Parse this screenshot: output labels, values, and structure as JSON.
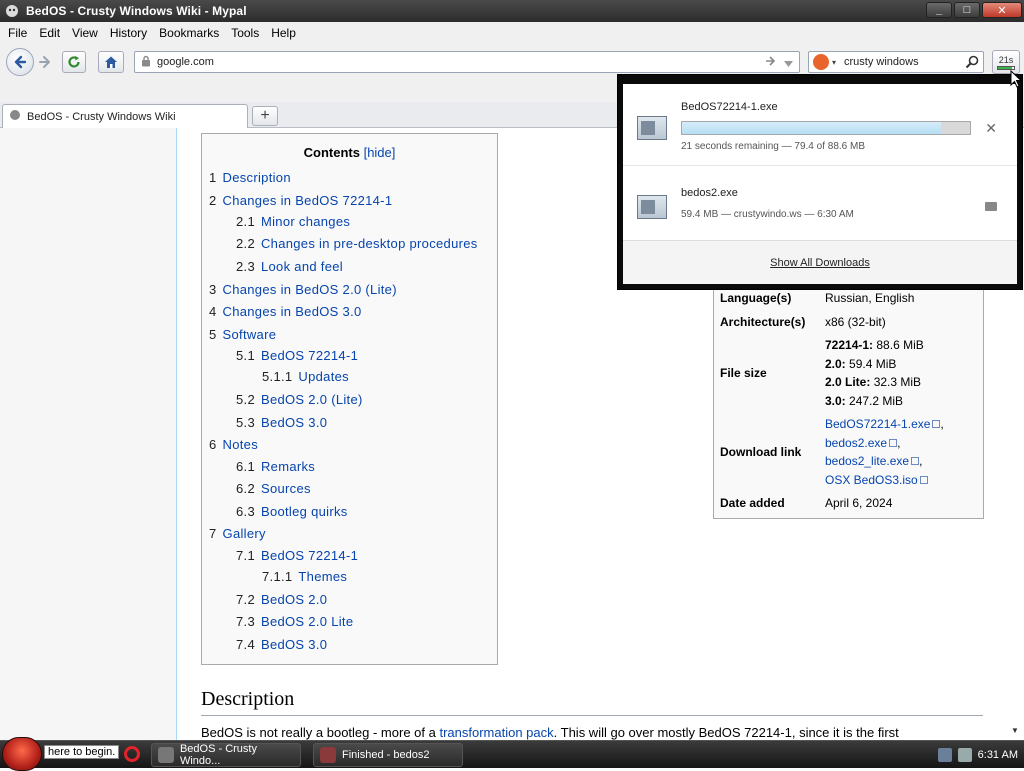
{
  "window": {
    "title": "BedOS - Crusty Windows Wiki - Mypal",
    "min": "_",
    "max": "□",
    "close": "✕"
  },
  "menu": [
    {
      "label": "File"
    },
    {
      "label": "Edit"
    },
    {
      "label": "View"
    },
    {
      "label": "History"
    },
    {
      "label": "Bookmarks"
    },
    {
      "label": "Tools"
    },
    {
      "label": "Help"
    }
  ],
  "nav": {
    "url": "google.com",
    "search_query": "crusty windows",
    "download_indicator_text": "21s",
    "download_progress": 0.9
  },
  "tabs": [
    {
      "label": "BedOS - Crusty Windows Wiki"
    }
  ],
  "newtab": "+",
  "toc": {
    "title": "Contents",
    "hide": "[hide]",
    "items": [
      {
        "num": "1",
        "label": "Description"
      },
      {
        "num": "2",
        "label": "Changes in BedOS 72214-1"
      },
      {
        "num": "2.1",
        "label": "Minor changes"
      },
      {
        "num": "2.2",
        "label": "Changes in pre-desktop procedures"
      },
      {
        "num": "2.3",
        "label": "Look and feel"
      },
      {
        "num": "3",
        "label": "Changes in BedOS 2.0 (Lite)"
      },
      {
        "num": "4",
        "label": "Changes in BedOS 3.0"
      },
      {
        "num": "5",
        "label": "Software"
      },
      {
        "num": "5.1",
        "label": "BedOS 72214-1"
      },
      {
        "num": "5.1.1",
        "label": "Updates"
      },
      {
        "num": "5.2",
        "label": "BedOS 2.0 (Lite)"
      },
      {
        "num": "5.3",
        "label": "BedOS 3.0"
      },
      {
        "num": "6",
        "label": "Notes"
      },
      {
        "num": "6.1",
        "label": "Remarks"
      },
      {
        "num": "6.2",
        "label": "Sources"
      },
      {
        "num": "6.3",
        "label": "Bootleg quirks"
      },
      {
        "num": "7",
        "label": "Gallery"
      },
      {
        "num": "7.1",
        "label": "BedOS 72214-1"
      },
      {
        "num": "7.1.1",
        "label": "Themes"
      },
      {
        "num": "7.2",
        "label": "BedOS 2.0"
      },
      {
        "num": "7.3",
        "label": "BedOS 2.0 Lite"
      },
      {
        "num": "7.4",
        "label": "BedOS 3.0"
      }
    ]
  },
  "infobox": {
    "language": {
      "label": "Language(s)",
      "value": "Russian, English"
    },
    "architecture": {
      "label": "Architecture(s)",
      "value": "x86 (32-bit)"
    },
    "filesize": {
      "label": "File size",
      "lines": [
        {
          "k": "72214-1:",
          "v": " 88.6 MiB"
        },
        {
          "k": "2.0:",
          "v": " 59.4 MiB"
        },
        {
          "k": "2.0 Lite:",
          "v": " 32.3 MiB"
        },
        {
          "k": "3.0:",
          "v": " 247.2 MiB"
        }
      ]
    },
    "download": {
      "label": "Download link",
      "links": [
        {
          "text": "BedOS72214-1.exe",
          "sep": ","
        },
        {
          "text": "bedos2.exe",
          "sep": ","
        },
        {
          "text": "bedos2_lite.exe",
          "sep": ","
        },
        {
          "text": "OSX BedOS3.iso",
          "sep": ""
        }
      ]
    },
    "date": {
      "label": "Date added",
      "value": "April 6, 2024"
    }
  },
  "description": {
    "heading": "Description",
    "text_pre": "BedOS is not really a bootleg - more of a ",
    "text_link": "transformation pack",
    "text_post": ". This will go over mostly BedOS 72214-1, since it is the first"
  },
  "downloads": {
    "items": [
      {
        "name": "BedOS72214-1.exe",
        "status": "21 seconds remaining — 79.4 of 88.6 MB",
        "progress": 0.9,
        "action": "✕"
      },
      {
        "name": "bedos2.exe",
        "status": "59.4 MB — crustywindo.ws — 6:30 AM"
      }
    ],
    "show_all": "Show All Downloads"
  },
  "taskbar": {
    "start_tip": "here to begin.",
    "tasks": [
      {
        "label": "BedOS - Crusty Windo..."
      },
      {
        "label": "Finished - bedos2"
      }
    ],
    "clock": "6:31 AM"
  },
  "colors": {
    "link": "#0645ad",
    "progress": "#b6def4"
  }
}
